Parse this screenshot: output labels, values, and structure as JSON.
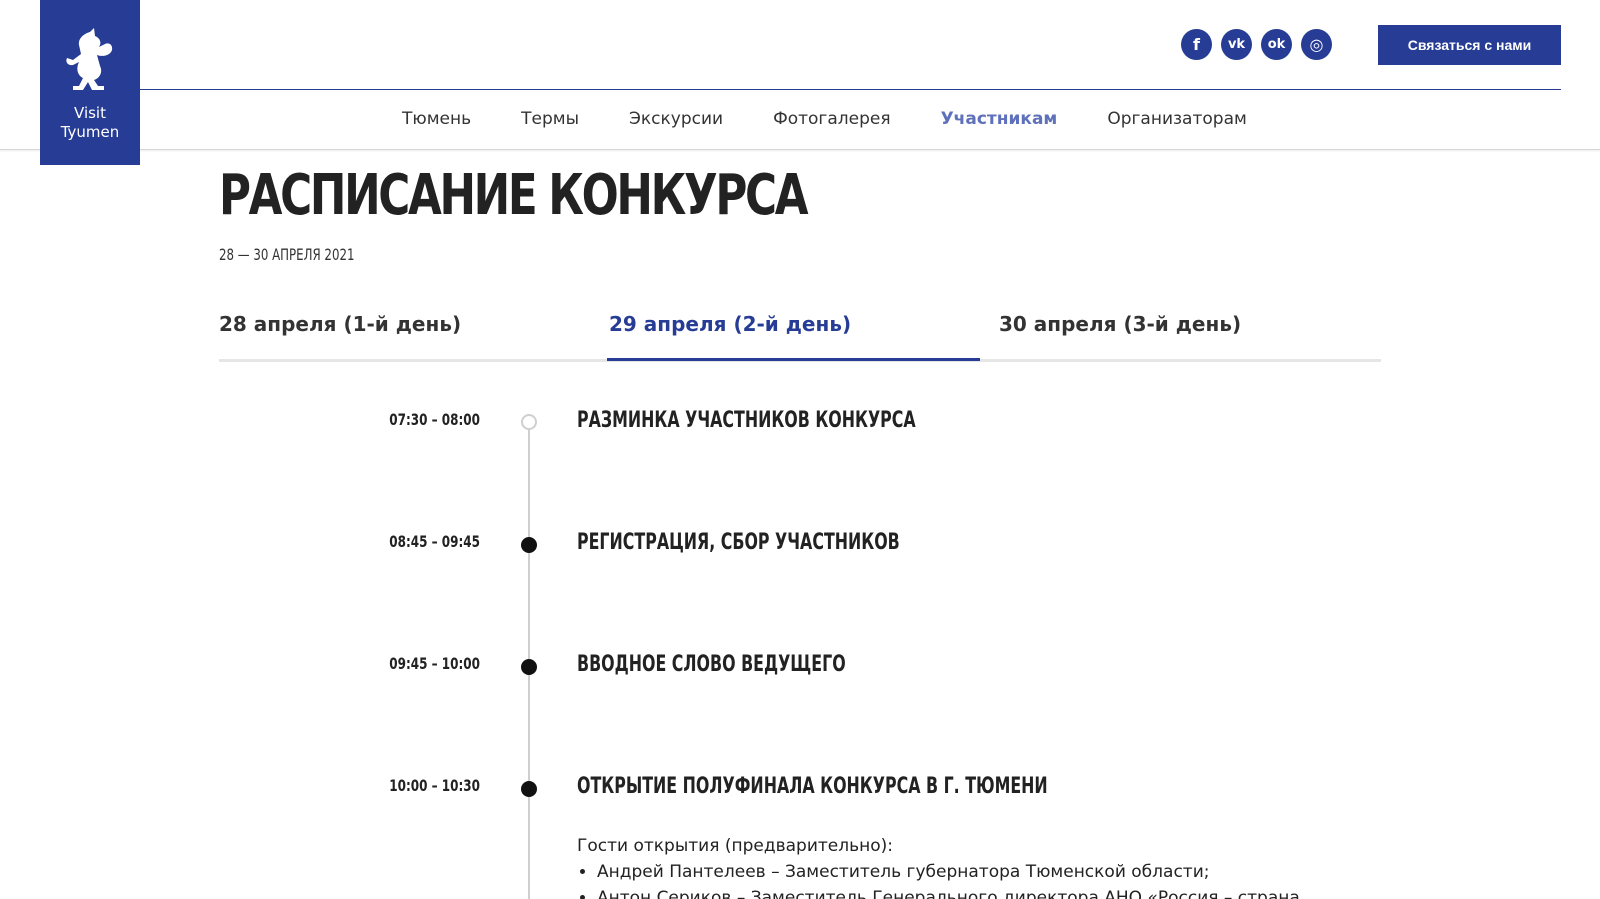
{
  "logo": {
    "line1": "Visit",
    "line2": "Tyumen",
    "icon": "fox-emblem-icon"
  },
  "header": {
    "socials": [
      {
        "name": "facebook-icon",
        "glyph": "f"
      },
      {
        "name": "vk-icon",
        "glyph": "vk"
      },
      {
        "name": "odnoklassniki-icon",
        "glyph": "ok"
      },
      {
        "name": "instagram-icon",
        "glyph": "◎"
      }
    ],
    "contact_label": "Связаться с нами"
  },
  "nav": {
    "items": [
      "Тюмень",
      "Термы",
      "Экскурсии",
      "Фотогалерея",
      "Участникам",
      "Организаторам"
    ],
    "active": "Участникам"
  },
  "page": {
    "title": "РАСПИСАНИЕ КОНКУРСА",
    "date": "28 — 30 АПРЕЛЯ 2021"
  },
  "tabs": [
    "28 апреля (1-й день)",
    "29 апреля (2-й день)",
    "30 апреля (3-й день)"
  ],
  "active_tab": "29 апреля (2-й день)",
  "events": [
    {
      "time": "07:30 – 08:00",
      "title": "РАЗМИНКА УЧАСТНИКОВ КОНКУРСА"
    },
    {
      "time": "08:45 – 09:45",
      "title": "РЕГИСТРАЦИЯ, СБОР УЧАСТНИКОВ"
    },
    {
      "time": "09:45 – 10:00",
      "title": "ВВОДНОЕ СЛОВО ВЕДУЩЕГО"
    },
    {
      "time": "10:00 – 10:30",
      "title": "ОТКРЫТИЕ ПОЛУФИНАЛА КОНКУРСА В Г. ТЮМЕНИ"
    }
  ],
  "guests": {
    "intro": "Гости открытия (предварительно):",
    "items": [
      "Андрей Пантелеев – Заместитель губернатора Тюменской области;",
      "Антон Сериков – Заместитель Генерального директора АНО «Россия – страна"
    ]
  }
}
